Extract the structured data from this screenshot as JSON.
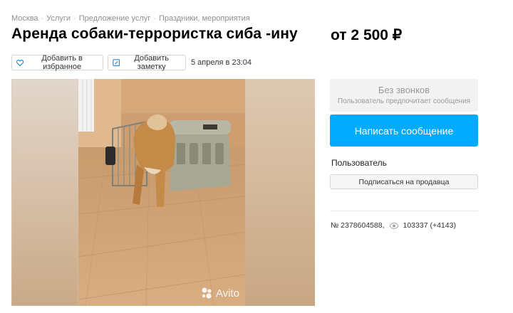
{
  "breadcrumb": [
    "Москва",
    "Услуги",
    "Предложение услуг",
    "Праздники, мероприятия"
  ],
  "title": "Аренда собаки-террористка сиба -ину",
  "price": "от 2 500 ₽",
  "actions": {
    "favorite_label": "Добавить в избранное",
    "note_label": "Добавить заметку",
    "date": "5 апреля в 23:04"
  },
  "watermark": "Avito",
  "contact": {
    "no_calls_title": "Без звонков",
    "no_calls_sub": "Пользователь предпочитает сообщения",
    "message_button": "Написать сообщение"
  },
  "seller": {
    "name": "Пользователь",
    "subscribe_label": "Подписаться на продавца"
  },
  "meta": {
    "ad_number": "№ 2378604588,",
    "views": "103337 (+4143)"
  },
  "colors": {
    "accent": "#00aaff",
    "heart": "#1a7fc9"
  }
}
